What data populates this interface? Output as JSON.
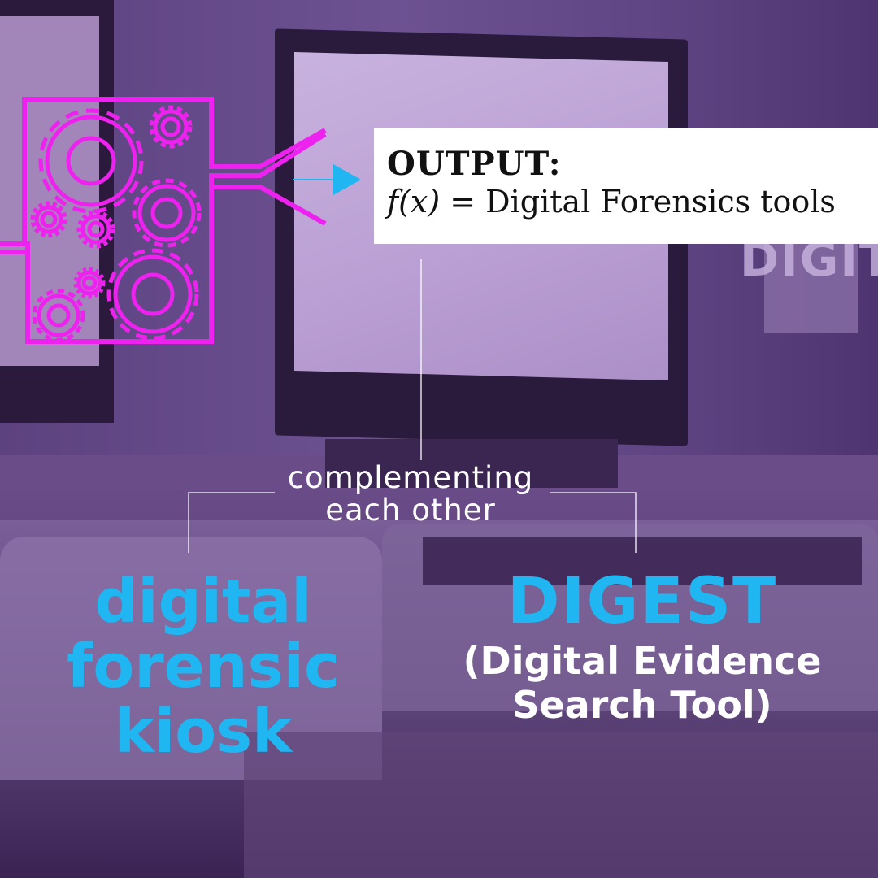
{
  "output": {
    "title": "OUTPUT:",
    "formula_lhs": "f(x)",
    "formula_rhs": " = Digital Forensics tools"
  },
  "background_sign": "DIGIT",
  "connector_label": {
    "line1": "complementing",
    "line2": "each other"
  },
  "left_item": {
    "lines": [
      "digital",
      "forensic",
      "kiosk"
    ]
  },
  "right_item": {
    "title": "DIGEST",
    "subtitle_line1": "(Digital Evidence",
    "subtitle_line2": "Search Tool)"
  },
  "icons": {
    "machine": "gears-machine-icon",
    "arrow": "arrow-right-icon"
  },
  "colors": {
    "magenta": "#ee22ee",
    "cyan": "#1fb6f2",
    "purple_overlay": "#6a4c88",
    "white": "#ffffff"
  }
}
